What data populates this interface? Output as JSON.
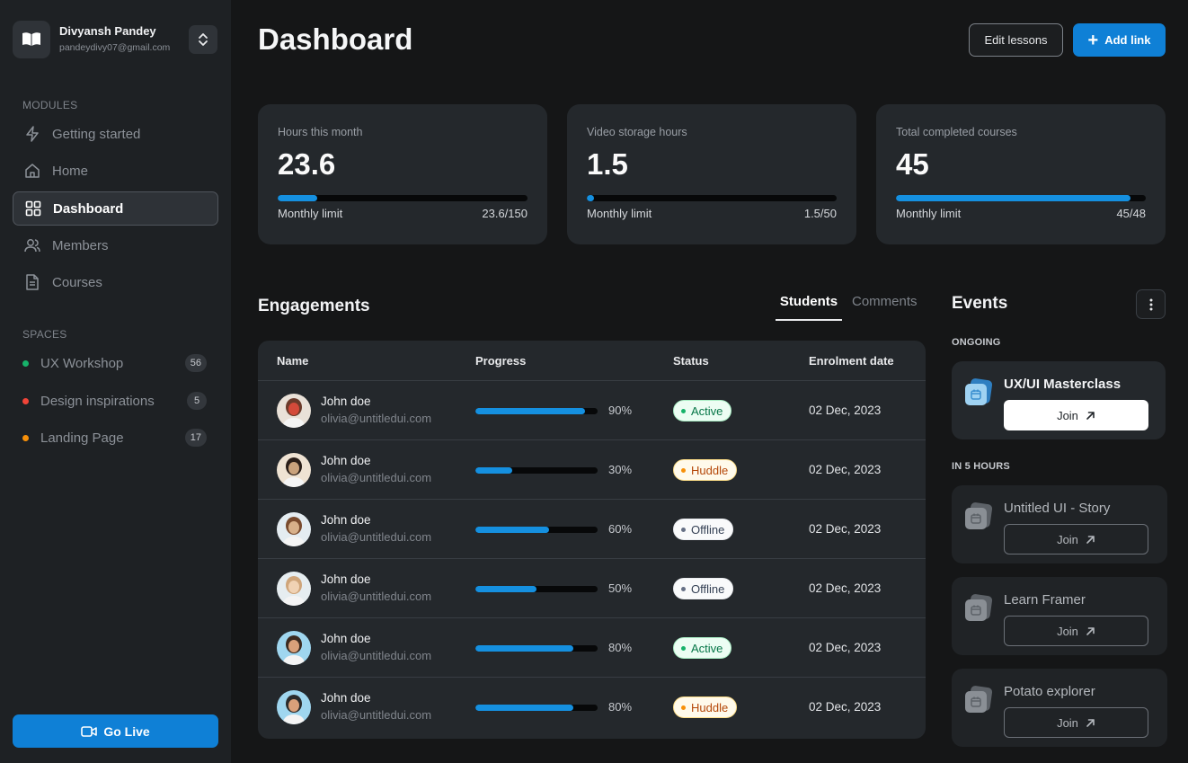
{
  "profile": {
    "name": "Divyansh Pandey",
    "email": "pandeydivy07@gmail.com"
  },
  "sidebar": {
    "modules_label": "MODULES",
    "items": [
      {
        "label": "Getting started",
        "icon": "lightning-icon"
      },
      {
        "label": "Home",
        "icon": "home-icon"
      },
      {
        "label": "Dashboard",
        "icon": "grid-icon",
        "active": true
      },
      {
        "label": "Members",
        "icon": "users-icon"
      },
      {
        "label": "Courses",
        "icon": "document-icon"
      }
    ],
    "spaces_label": "SPACES",
    "spaces": [
      {
        "label": "UX Workshop",
        "count": "56",
        "color": "#17b26a"
      },
      {
        "label": "Design inspirations",
        "count": "5",
        "color": "#f04438"
      },
      {
        "label": "Landing Page",
        "count": "17",
        "color": "#f79009"
      }
    ],
    "go_live_label": "Go Live"
  },
  "header": {
    "title": "Dashboard",
    "edit_label": "Edit lessons",
    "add_label": "Add link"
  },
  "stats": [
    {
      "label": "Hours this month",
      "value": "23.6",
      "foot_label": "Monthly limit",
      "foot_value": "23.6/150",
      "progress": 0.157
    },
    {
      "label": "Video storage hours",
      "value": "1.5",
      "foot_label": "Monthly limit",
      "foot_value": "1.5/50",
      "progress": 0.03
    },
    {
      "label": "Total completed courses",
      "value": "45",
      "foot_label": "Monthly limit",
      "foot_value": "45/48",
      "progress": 0.9375
    }
  ],
  "engagements": {
    "title": "Engagements",
    "tabs": [
      "Students",
      "Comments"
    ],
    "columns": [
      "Name",
      "Progress",
      "Status",
      "Enrolment date"
    ],
    "rows": [
      {
        "name": "John doe",
        "email": "olivia@untitledui.com",
        "progress": "90%",
        "status": "Active",
        "date": "02 Dec, 2023"
      },
      {
        "name": "John doe",
        "email": "olivia@untitledui.com",
        "progress": "30%",
        "status": "Huddle",
        "date": "02 Dec, 2023"
      },
      {
        "name": "John doe",
        "email": "olivia@untitledui.com",
        "progress": "60%",
        "status": "Offline",
        "date": "02 Dec, 2023"
      },
      {
        "name": "John doe",
        "email": "olivia@untitledui.com",
        "progress": "50%",
        "status": "Offline",
        "date": "02 Dec, 2023"
      },
      {
        "name": "John doe",
        "email": "olivia@untitledui.com",
        "progress": "80%",
        "status": "Active",
        "date": "02 Dec, 2023"
      },
      {
        "name": "John doe",
        "email": "olivia@untitledui.com",
        "progress": "80%",
        "status": "Huddle",
        "date": "02 Dec, 2023"
      }
    ]
  },
  "events": {
    "title": "Events",
    "ongoing_label": "ONGOING",
    "ongoing": [
      {
        "name": "UX/UI Masterclass",
        "join": "Join"
      }
    ],
    "later_label": "IN 5 HOURS",
    "later": [
      {
        "name": "Untitled UI - Story",
        "join": "Join"
      },
      {
        "name": "Learn Framer",
        "join": "Join"
      },
      {
        "name": "Potato explorer",
        "join": "Join"
      }
    ]
  },
  "colors": {
    "accent": "#0f80d6",
    "progress": "#1590e0",
    "active": "#17b26a",
    "huddle": "#f79009",
    "offline": "#667085"
  }
}
